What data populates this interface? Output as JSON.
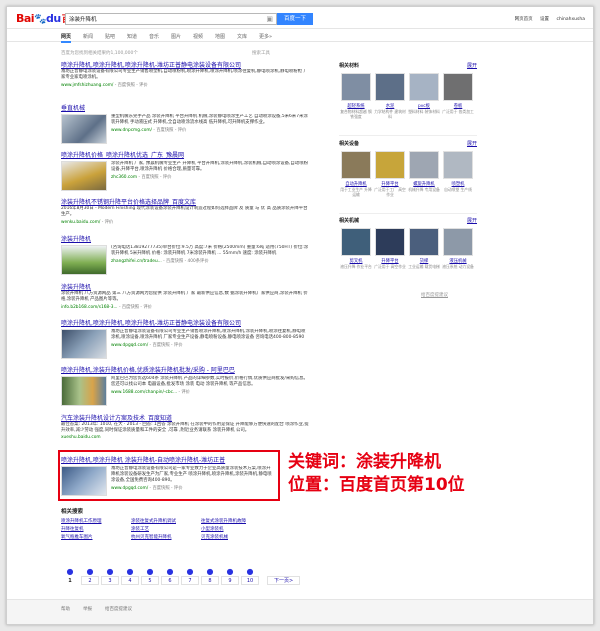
{
  "header": {
    "logo_part1": "Bai",
    "logo_paw": "🐾",
    "logo_part2": "du",
    "logo_cn": "百度",
    "query": "涂装升降机",
    "camera_icon": "camera-icon",
    "search_button": "百度一下",
    "user_links": [
      "网页首页",
      "设置",
      "chinahxusha"
    ]
  },
  "nav": {
    "tabs": [
      "网页",
      "新闻",
      "贴吧",
      "知道",
      "音乐",
      "图片",
      "视频",
      "地图",
      "文库",
      "更多»"
    ]
  },
  "info_line": "百度为您找到相关结果约1,100,000个",
  "tools_link": "搜索工具",
  "results": [
    {
      "title": "喷涂升降机,喷涂升降机,喷涂升降机-潍坊正普静电涂装设备有限公司",
      "abstract": "潍坊正普静电涂装设备有限公司专业生产销售喷塑机,自动喷粉机,喷涂升降机,喷涂升降机,喷涂往复机,静电喷涂机,静电喷粉枪 厂家专业家电喷涂机。",
      "url": "www.jmfshizhuang.com/",
      "url_extra": "- 百度快照 - 评价"
    },
    {
      "title": "垂直机械",
      "abstract": "重型机械东莞手产品 涂装升降机 平台升降机 机械,涂装静电喷涂生产工艺 自动喷涂设备,5米6米7米涂装升降机 手动液压式 升降机,全自动喷涂流水线高 低升降机,可升降机支撑作业。",
      "url": "www.dnpcmg.com/",
      "url_extra": "- 百度快照 - 评价"
    },
    {
      "title": "喷涂升降机价格_喷涂升降机优选_广东_豫晨网",
      "abstract": "涂装升降机 厂家, 豫晨机械专业生产 升降机 平台升降机,涂装升降机,涂装机械,自动喷涂设备,自动喷粉设备,升降平台,喷涂升降机 价格合理,质量可靠。",
      "url": "zhc360.com",
      "url_extra": "- 百度快照 - 评价"
    },
    {
      "title": "涂装升降机不锈钢升降平台价格选择品牌_百度文库",
      "abstract": "2016年8月30日 - Modern Finishing 现代涂装设备涂装升降机设计制造过程如何选择品牌 及 质量 与 优 高 品质涂装升降平台 生产。",
      "url": "wenku.baidu.com/",
      "url_extra": "- 评价"
    },
    {
      "title": "涂装升降机",
      "abstract": "(咨询电话13819277735)单台价位:9.5万 高度:7米 价格(2500mm) 重量:6吨 适用(750HT) 价位:涂装升降机 5米升降机 价格: 涂装升降机 7米涂装升降机 ... 55mm/h 速度: 涂装升降机",
      "url": "zhangzhifei.cn/tradeu...",
      "url_extra": "- 百度快照 - 400条评价"
    },
    {
      "title": "涂装升降机",
      "abstract": "涂装升降机 八方资源网品 第三 八方资源网为您提供 涂装升降机 厂家 最新供应信息,数 据涂装升降机厂家供应商,涂装升降机 价格,涂装升降机 产品图片等等。",
      "url": "info.b2b168.com/s168-3...",
      "url_extra": "- 百度快照 - 评价"
    },
    {
      "title": "喷涂升降机,喷涂升降机,喷涂升降机-潍坊正普静电涂装设备有限公司",
      "abstract": "潍坊正普静电涂装设备有限公司专业生产销售喷涂升降机,喷涂升降机,涂装升降机,喷涂往复机,静电喷涂机,喷涂设备,喷涂升降机 厂家专业生产设备,静电喷粉设备,静电喷涂设备 咨询电话400-800-8590",
      "url": "www.dpgqd.com/",
      "url_extra": "- 百度快照 - 评价"
    },
    {
      "title": "喷涂升降机,涂装升降机价格,优质涂装升降机批发/采购 - 阿里巴巴",
      "abstract": "阿里巴巴为您优选604条 涂装升降机 产品的详细参数,实时报价,价格行情,优质供应商批发/采购信息。您还可以找公司本 电器设备,批发市场 涂装 电动 涂装升降机 等产品信息。",
      "url": "www.1688.com/chanpin/-cbc...",
      "url_extra": "- 评价"
    },
    {
      "title": "汽车涂装升降机设计方案及技术_百度知道",
      "abstract": "最佳答案: 2013年: 1010, 在大 · 2013 - 回答: 1回答 涂装升降机 在涂装中的作用是保证 升降能够方便快速的配合 喷涂作业,提升效率,减少劳动 强度,同时保证涂装质量和工件的安全 ,可靠 ,附近业务请联系 涂装升降机 公司。",
      "url": "xueshu.baidu.com",
      "url_extra": ""
    },
    {
      "title": "喷涂升降机,喷涂升降机 涂装升降机-自动喷涂升降机-潍坊正普",
      "abstract": "潍坊正普静电涂装设备有限公司是一家专业致力于企业高质量涂装技术方案,喷涂升降机涂装设备研发生产为厂家,专业生产 喷涂升降机,喷涂升降机,涂装升降机,静电喷涂设备,全国免费咨询400-890。",
      "url": "www.dpgqd.com/",
      "url_extra": "- 百度快照 - 评价"
    }
  ],
  "annotation": {
    "line1": "关键词：涂装升降机",
    "line2": "位置：百度首页第10位",
    "color": "#e60012"
  },
  "related": {
    "title": "相关搜索",
    "items": [
      "喷涂升降机工作原理",
      "涂装往复式升降机调试",
      "往复式涂装升降机故障",
      "升降往复机",
      "涂装工艺",
      "小型涂装机",
      "氧气瓶推车图片",
      "杭州贝克智能升降机",
      "贝克涂装机械"
    ]
  },
  "pager": {
    "pages": [
      "1",
      "2",
      "3",
      "4",
      "5",
      "6",
      "7",
      "8",
      "9",
      "10"
    ],
    "current": "1",
    "next": "下一页>"
  },
  "footer": {
    "links": [
      "帮助",
      "举报",
      "给百度提建议"
    ]
  },
  "sidebar": {
    "sections": [
      {
        "title": "相关材料",
        "expand": "展开",
        "items": [
          {
            "name": "超轻系统",
            "desc": "复合物材料超越 钢铁强度",
            "color": "#7f8ea3"
          },
          {
            "name": "水泥",
            "desc": "力学结构件 建筑材料",
            "color": "#5d6f88"
          },
          {
            "name": "pvc板",
            "desc": "塑料材料 装饰材料",
            "color": "#a6b3c4"
          },
          {
            "name": "卷板",
            "desc": "广泛用于 各类加工",
            "color": "#6f6f70"
          }
        ]
      },
      {
        "title": "相关设备",
        "expand": "展开",
        "items": [
          {
            "name": "自动升降机",
            "desc": "用于工业生产 升降运输",
            "color": "#8a7a5a"
          },
          {
            "name": "升降平台",
            "desc": "广泛用于工厂 高空作业",
            "color": "#c7a53a"
          },
          {
            "name": "螺旋升降机",
            "desc": "机械升降 专用设备",
            "color": "#9ea6b2"
          },
          {
            "name": "喷塑机",
            "desc": "自动喷塑 生产线",
            "color": "#b0b8c2"
          }
        ]
      },
      {
        "title": "相关机械",
        "expand": "展开",
        "items": [
          {
            "name": "剪叉机",
            "desc": "液压升降 作业平台",
            "color": "#3f5f7a"
          },
          {
            "name": "升降平台",
            "desc": "广泛用于 高空作业",
            "color": "#2d3c5a"
          },
          {
            "name": "货梯",
            "desc": "工业运输 载货电梯",
            "color": "#4b5f7d"
          },
          {
            "name": "液压机械",
            "desc": "液压系统 动力设备",
            "color": "#8d99a8"
          }
        ]
      }
    ],
    "feedback": "给百度提建议"
  },
  "colors": {
    "link": "#1a0dab",
    "highlight": "#c00",
    "url": "#008000",
    "button": "#3385ff"
  }
}
